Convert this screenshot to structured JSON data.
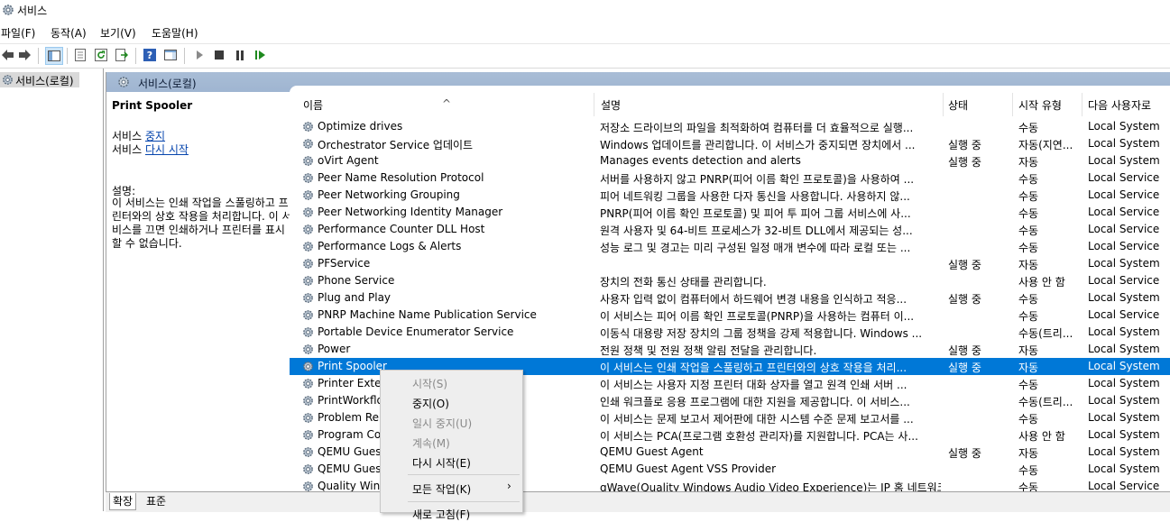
{
  "window": {
    "title": "서비스"
  },
  "menu": [
    "파일(F)",
    "동작(A)",
    "보기(V)",
    "도움말(H)"
  ],
  "toolbar_icons": [
    "back-arrow-icon",
    "forward-arrow-icon",
    "show-hide-console-tree-icon",
    "properties-icon",
    "refresh-icon",
    "export-list-icon",
    "help-icon",
    "show-action-pane-icon",
    "start-service-icon",
    "stop-service-icon",
    "pause-service-icon",
    "restart-service-icon"
  ],
  "tree": {
    "root_label": "서비스(로컬)"
  },
  "main": {
    "header_label": "서비스(로컬)"
  },
  "detail": {
    "service_name": "Print Spooler",
    "action_prefix": "서비스",
    "stop_link": "중지",
    "restart_link": "다시 시작",
    "desc_label": "설명:",
    "desc_text": "이 서비스는 인쇄 작업을 스풀링하고 프린터와의 상호 작용을 처리합니다. 이 서비스를 끄면 인쇄하거나 프린터를 표시할 수 없습니다."
  },
  "columns": [
    "이름",
    "설명",
    "상태",
    "시작 유형",
    "다음 사용자로 로그온"
  ],
  "columns_display": [
    "이름",
    "설명",
    "상태",
    "시작 유형",
    "다음 사용자로"
  ],
  "rows": [
    {
      "name": "Optimize drives",
      "desc": "저장소 드라이브의 파일을 최적화하여 컴퓨터를 더 효율적으로 실행...",
      "status": "",
      "start": "수동",
      "logon": "Local System"
    },
    {
      "name": "Orchestrator Service 업데이트",
      "desc": "Windows 업데이트를 관리합니다. 이 서비스가 중지되면 장치에서 ...",
      "status": "실행 중",
      "start": "자동(지연...",
      "logon": "Local System"
    },
    {
      "name": "oVirt Agent",
      "desc": " Manages events detection and alerts",
      "status": "실행 중",
      "start": "자동",
      "logon": "Local System"
    },
    {
      "name": "Peer Name Resolution Protocol",
      "desc": "서버를 사용하지 않고 PNRP(피어 이름 확인 프로토콜)을 사용하여 ...",
      "status": "",
      "start": "수동",
      "logon": "Local Service"
    },
    {
      "name": "Peer Networking Grouping",
      "desc": "피어 네트워킹 그룹을 사용한 다자 통신을 사용합니다. 사용하지 않...",
      "status": "",
      "start": "수동",
      "logon": "Local Service"
    },
    {
      "name": "Peer Networking Identity Manager",
      "desc": "PNRP(피어 이름 확인 프로토콜) 및 피어 투 피어 그룹 서비스에 사...",
      "status": "",
      "start": "수동",
      "logon": "Local Service"
    },
    {
      "name": "Performance Counter DLL Host",
      "desc": "원격 사용자 및 64-비트 프로세스가 32-비트 DLL에서 제공되는 성...",
      "status": "",
      "start": "수동",
      "logon": "Local Service"
    },
    {
      "name": "Performance Logs & Alerts",
      "desc": "성능 로그 및 경고는 미리 구성된 일정 매개 변수에 따라 로컬 또는 ...",
      "status": "",
      "start": "수동",
      "logon": "Local Service"
    },
    {
      "name": "PFService",
      "desc": "",
      "status": "실행 중",
      "start": "자동",
      "logon": "Local System"
    },
    {
      "name": "Phone Service",
      "desc": "장치의 전화 통신 상태를 관리합니다.",
      "status": "",
      "start": "사용 안 함",
      "logon": "Local Service"
    },
    {
      "name": "Plug and Play",
      "desc": "사용자 입력 없이 컴퓨터에서 하드웨어 변경 내용을 인식하고 적응...",
      "status": "실행 중",
      "start": "수동",
      "logon": "Local System"
    },
    {
      "name": "PNRP Machine Name Publication Service",
      "desc": "이 서비스는 피어 이름 확인 프로토콜(PNRP)을 사용하는 컴퓨터 이...",
      "status": "",
      "start": "수동",
      "logon": "Local Service"
    },
    {
      "name": "Portable Device Enumerator Service",
      "desc": "이동식 대용량 저장 장치의 그룹 정책을 강제 적용합니다. Windows ...",
      "status": "",
      "start": "수동(트리...",
      "logon": "Local System"
    },
    {
      "name": "Power",
      "desc": "전원 정책 및 전원 정책 알림 전달을 관리합니다.",
      "status": "실행 중",
      "start": "자동",
      "logon": "Local System"
    },
    {
      "name": "Print Spooler",
      "desc": "이 서비스는 인쇄 작업을 스풀링하고 프린터와의 상호 작용을 처리...",
      "status": "실행 중",
      "start": "자동",
      "logon": "Local System",
      "selected": true
    },
    {
      "name": "Printer Exten",
      "desc": "이 서비스는 사용자 지정 프린터 대화 상자를 열고 원격 인쇄 서버 ...",
      "status": "",
      "start": "수동",
      "logon": "Local System"
    },
    {
      "name": "PrintWorkflo",
      "desc": "인쇄 워크플로 응용 프로그램에 대한 지원을 제공합니다. 이 서비스...",
      "status": "",
      "start": "수동(트리...",
      "logon": "Local System"
    },
    {
      "name": "Problem Rep",
      "desc": "이 서비스는 문제 보고서 제어판에 대한 시스템 수준 문제 보고서를 ...",
      "status": "",
      "start": "수동",
      "logon": "Local System"
    },
    {
      "name": "Program Cor",
      "desc": "이 서비스는 PCA(프로그램 호환성 관리자)를 지원합니다. PCA는 사...",
      "status": "",
      "start": "사용 안 함",
      "logon": "Local System"
    },
    {
      "name": "QEMU Guest",
      "desc": "QEMU Guest Agent",
      "status": "실행 중",
      "start": "자동",
      "logon": "Local System"
    },
    {
      "name": "QEMU Guest",
      "desc": "QEMU Guest Agent VSS Provider",
      "status": "",
      "start": "수동",
      "logon": "Local System"
    },
    {
      "name": "Quality Wind",
      "desc": "qWave(Quality Windows Audio Video Experience)는 IP 홈 네트워크...",
      "status": "",
      "start": "수동",
      "logon": "Local Service"
    }
  ],
  "tabs": [
    "확장",
    "표준"
  ],
  "context_menu": {
    "start": "시작(S)",
    "stop": "중지(O)",
    "pause": "일시 중지(U)",
    "resume": "계속(M)",
    "restart": "다시 시작(E)",
    "all_tasks": "모든 작업(K)",
    "all_tasks_arrow": "›",
    "refresh": "새로 고침(F)"
  },
  "colors": {
    "selection": "#0078d7",
    "header": "#a9bdd6",
    "link": "#0645ad"
  }
}
